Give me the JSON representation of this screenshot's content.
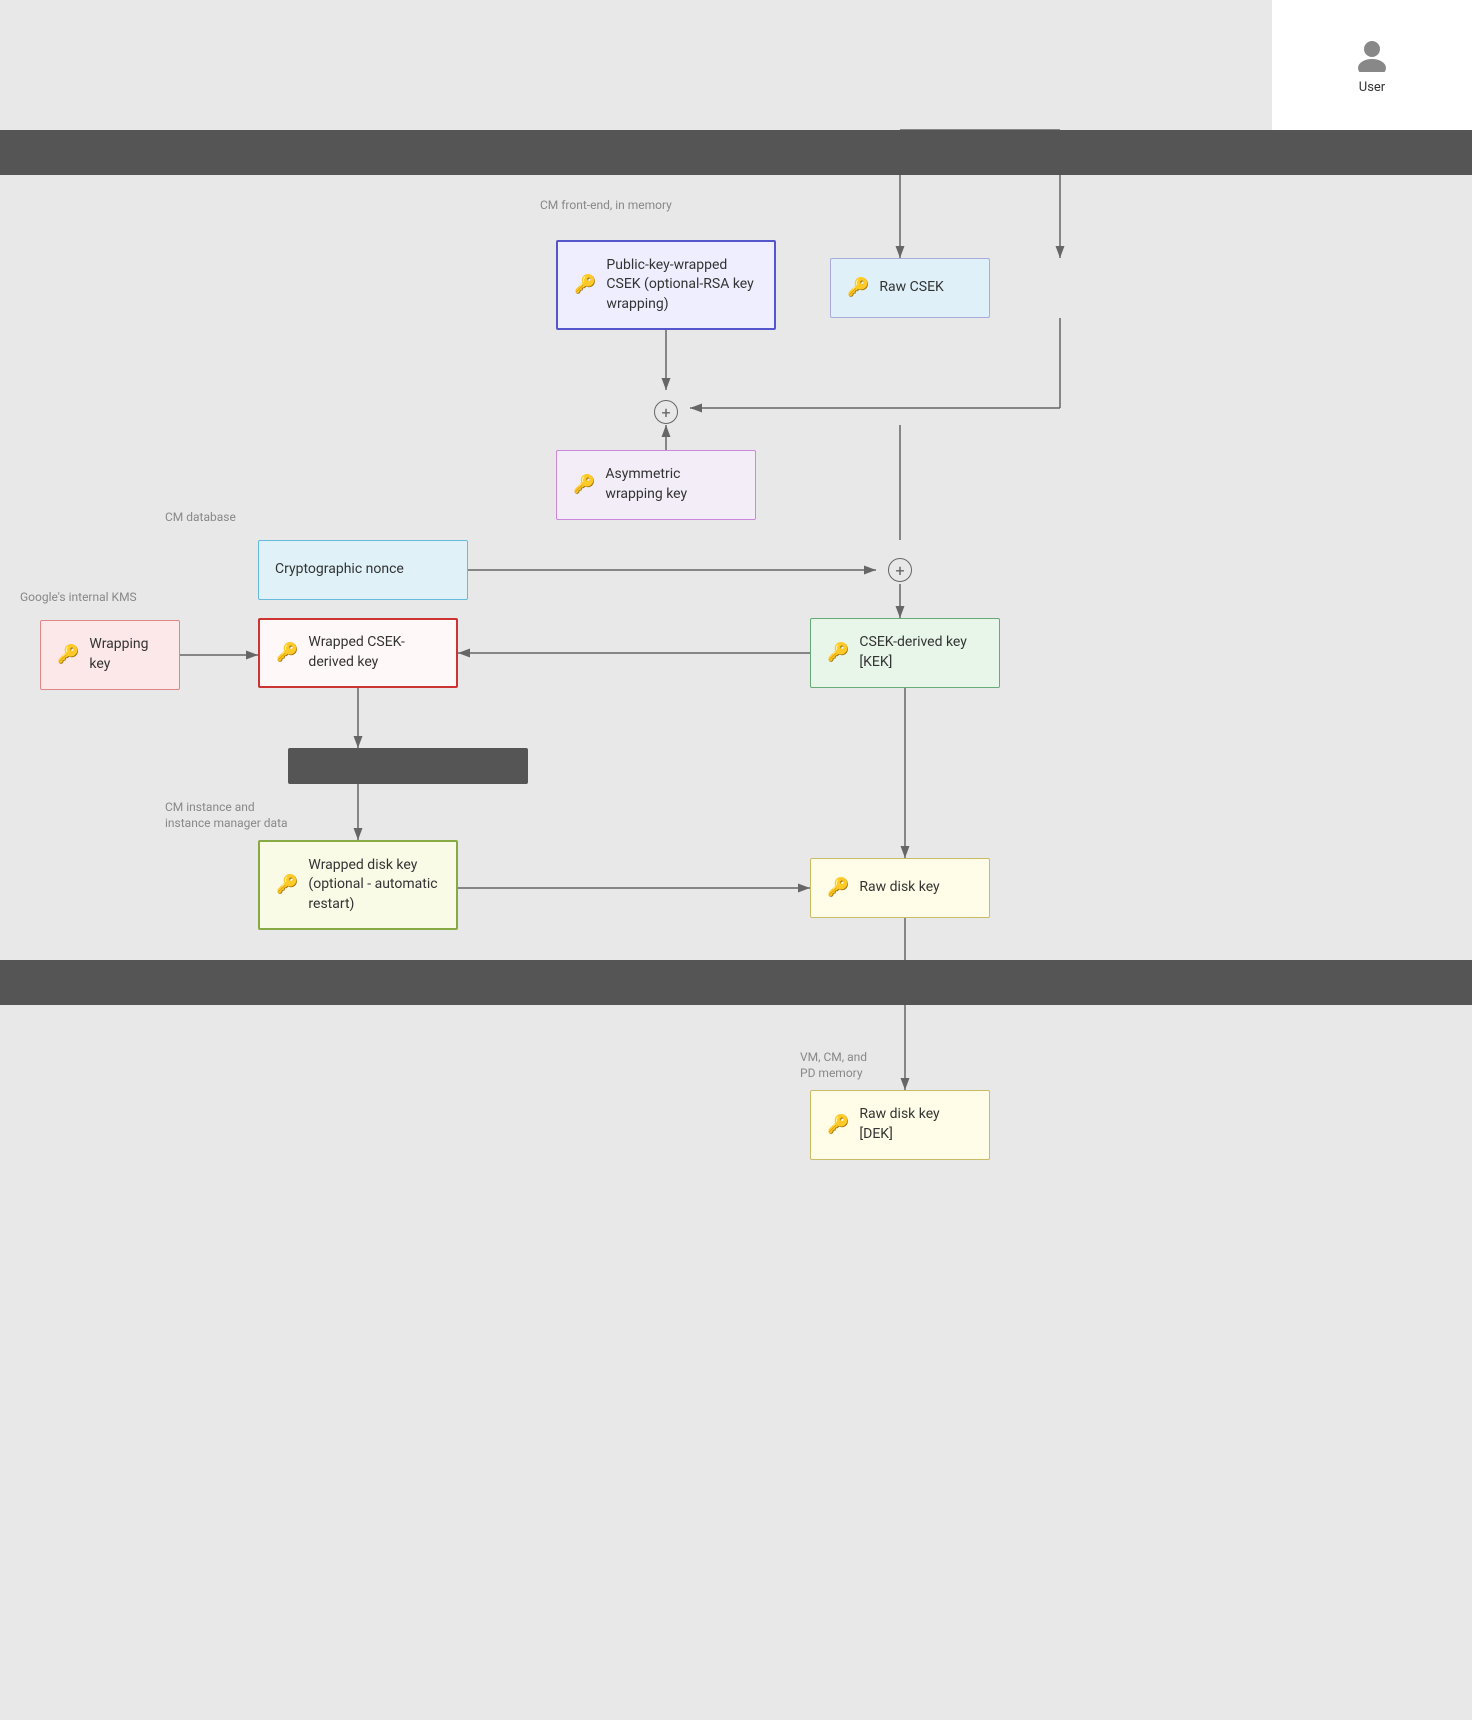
{
  "user": {
    "label": "User",
    "icon": "person"
  },
  "boxes": {
    "public_key": {
      "label": "Public-key-wrapped CSEK (optional-RSA key wrapping)",
      "border_color": "#5555cc",
      "bg_color": "#eef"
    },
    "raw_csek": {
      "label": "Raw CSEK",
      "border_color": "#aad",
      "bg_color": "#e0f0f8"
    },
    "asymmetric": {
      "label": "Asymmetric wrapping key",
      "border_color": "#cc88dd",
      "bg_color": "#f3edf8"
    },
    "nonce": {
      "label": "Cryptographic nonce",
      "border_color": "#66bbdd",
      "bg_color": "#e0f2f8"
    },
    "wrapping_key": {
      "label": "Wrapping key",
      "border_color": "#dd8888",
      "bg_color": "#fce8e8"
    },
    "wrapped_csek": {
      "label": "Wrapped CSEK-derived key",
      "border_color": "#cc3333",
      "bg_color": "#fff8f8"
    },
    "csek_derived": {
      "label": "CSEK-derived key [KEK]",
      "border_color": "#66aa77",
      "bg_color": "#e8f5e9"
    },
    "wrapped_disk": {
      "label": "Wrapped disk key (optional - automatic restart)",
      "border_color": "#88aa44",
      "bg_color": "#f9fbe7"
    },
    "raw_disk": {
      "label": "Raw disk key",
      "border_color": "#ccbb66",
      "bg_color": "#fffde7"
    },
    "raw_disk_dek": {
      "label": "Raw disk key [DEK]",
      "border_color": "#ccbb66",
      "bg_color": "#fffde7"
    }
  },
  "labels": {
    "cm_frontend": "CM front-end, in memory",
    "cm_database": "CM database",
    "googles_kms": "Google's internal KMS",
    "cm_instance": "CM instance and\ninstance manager data",
    "vm_cm_pd": "VM, CM, and\nPD memory"
  },
  "key_icon": "🔑",
  "plus_symbol": "+"
}
